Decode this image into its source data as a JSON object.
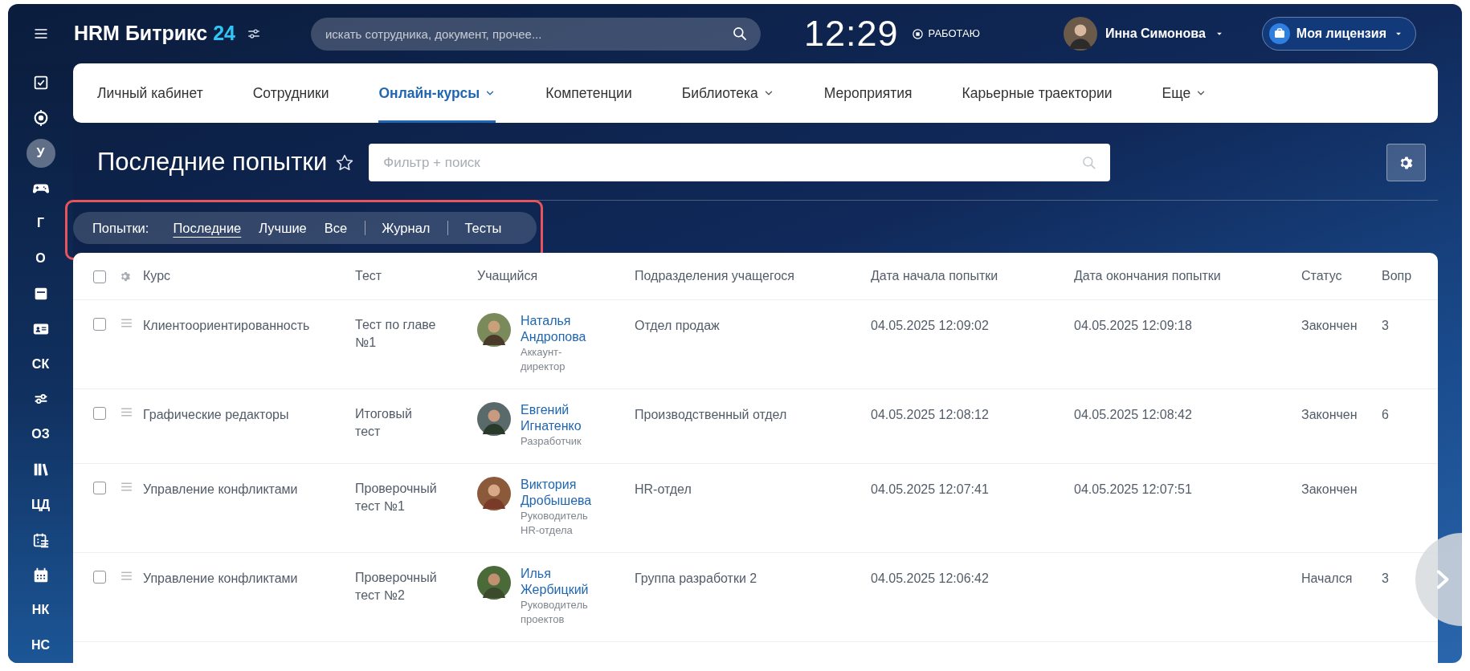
{
  "topbar": {
    "logo": "HRM Битрикс",
    "logo_number": "24",
    "search_placeholder": "искать сотрудника, документ, прочее...",
    "clock": "12:29",
    "work_status": "РАБОТАЮ",
    "user_name": "Инна Симонова",
    "license_button": "Моя лицензия"
  },
  "sidebar": {
    "items": [
      {
        "kind": "icon",
        "selected": false
      },
      {
        "kind": "icon",
        "selected": false
      },
      {
        "kind": "text",
        "label": "У",
        "selected": true
      },
      {
        "kind": "icon",
        "selected": false
      },
      {
        "kind": "text",
        "label": "Г",
        "selected": false
      },
      {
        "kind": "text",
        "label": "О",
        "selected": false
      },
      {
        "kind": "icon",
        "selected": false
      },
      {
        "kind": "icon",
        "selected": false
      },
      {
        "kind": "text",
        "label": "СК",
        "selected": false
      },
      {
        "kind": "icon",
        "selected": false
      },
      {
        "kind": "text",
        "label": "ОЗ",
        "selected": false
      },
      {
        "kind": "icon",
        "selected": false
      },
      {
        "kind": "text",
        "label": "ЦД",
        "selected": false
      },
      {
        "kind": "icon",
        "selected": false
      },
      {
        "kind": "icon",
        "selected": false
      },
      {
        "kind": "text",
        "label": "НК",
        "selected": false
      },
      {
        "kind": "text",
        "label": "НС",
        "selected": false
      }
    ]
  },
  "nav": {
    "items": [
      {
        "label": "Личный кабинет",
        "selected": false,
        "dropdown": false
      },
      {
        "label": "Сотрудники",
        "selected": false,
        "dropdown": false
      },
      {
        "label": "Онлайн-курсы",
        "selected": true,
        "dropdown": true
      },
      {
        "label": "Компетенции",
        "selected": false,
        "dropdown": false
      },
      {
        "label": "Библиотека",
        "selected": false,
        "dropdown": true
      },
      {
        "label": "Мероприятия",
        "selected": false,
        "dropdown": false
      },
      {
        "label": "Карьерные траектории",
        "selected": false,
        "dropdown": false
      },
      {
        "label": "Еще",
        "selected": false,
        "dropdown": true
      }
    ]
  },
  "page": {
    "title": "Последние попытки",
    "filter_placeholder": "Фильтр + поиск"
  },
  "attempts_filter": {
    "label": "Попытки:",
    "groups": [
      [
        {
          "label": "Последние",
          "selected": true
        },
        {
          "label": "Лучшие",
          "selected": false
        },
        {
          "label": "Все",
          "selected": false
        }
      ],
      [
        {
          "label": "Журнал",
          "selected": false
        }
      ],
      [
        {
          "label": "Тесты",
          "selected": false
        }
      ]
    ]
  },
  "table": {
    "header_checked": false,
    "columns": [
      "Курс",
      "Тест",
      "Учащийся",
      "Подразделения учащегося",
      "Дата начала попытки",
      "Дата окончания попытки",
      "Статус",
      "Вопр"
    ],
    "rows": [
      {
        "checked": false,
        "course": "Клиентоориентированность",
        "test": "Тест по главе №1",
        "student": "Наталья Андропова",
        "role": "Аккаунт-директор",
        "department": "Отдел продаж",
        "start": "04.05.2025 12:09:02",
        "end": "04.05.2025 12:09:18",
        "status": "Закончен",
        "questions": "3"
      },
      {
        "checked": false,
        "course": "Графические редакторы",
        "test": "Итоговый тест",
        "student": "Евгений Игнатенко",
        "role": "Разработчик",
        "department": "Производственный отдел",
        "start": "04.05.2025 12:08:12",
        "end": "04.05.2025 12:08:42",
        "status": "Закончен",
        "questions": "6"
      },
      {
        "checked": false,
        "course": "Управление конфликтами",
        "test": "Проверочный тест №1",
        "student": "Виктория Дробышева",
        "role": "Руководитель HR-отдела",
        "department": "HR-отдел",
        "start": "04.05.2025 12:07:41",
        "end": "04.05.2025 12:07:51",
        "status": "Закончен"
      },
      {
        "checked": false,
        "course": "Управление конфликтами",
        "test": "Проверочный тест №2",
        "student": "Илья Жербицкий",
        "role": "Руководитель проектов",
        "department": "Группа разработки 2",
        "start": "04.05.2025 12:06:42",
        "status": "Начался",
        "questions": "3"
      }
    ]
  }
}
